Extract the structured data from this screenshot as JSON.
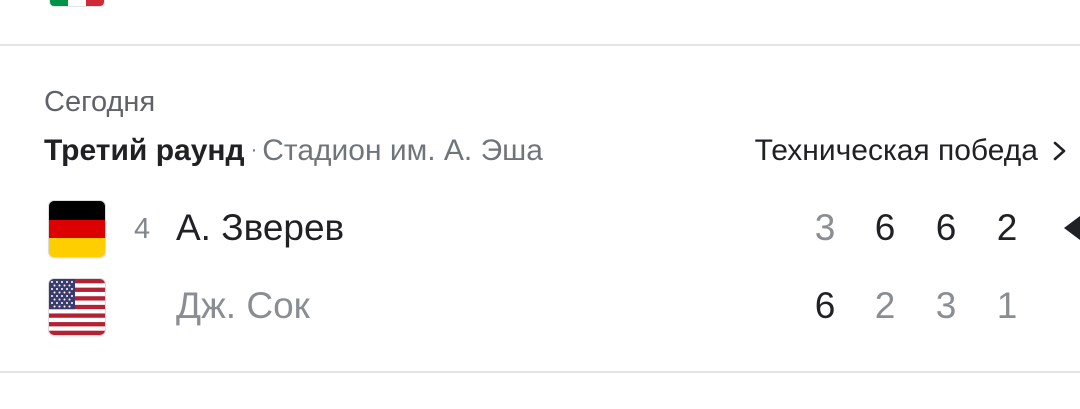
{
  "previous_match": {
    "flag_icon": "italy-flag-icon",
    "flag_colors": [
      "#009246",
      "#ffffff",
      "#ce2b37"
    ]
  },
  "match": {
    "date": "Сегодня",
    "round": "Третий раунд",
    "separator": "·",
    "venue": "Стадион им. А. Эша",
    "result_label": "Техническая победа",
    "result_icon": "chevron-right-icon",
    "players": [
      {
        "seed": "4",
        "name": "А. Зверев",
        "flag_icon": "germany-flag-icon",
        "is_winner": true,
        "sets": [
          "3",
          "6",
          "6",
          "2"
        ]
      },
      {
        "seed": "",
        "name": "Дж. Сок",
        "flag_icon": "usa-flag-icon",
        "is_winner": false,
        "sets": [
          "6",
          "2",
          "3",
          "1"
        ]
      }
    ],
    "winner_marker_icon": "winner-arrow-icon"
  },
  "colors": {
    "primary_text": "#202124",
    "secondary_text": "#70757a",
    "muted_score": "#8a8e92",
    "divider": "#e4e4e4"
  }
}
